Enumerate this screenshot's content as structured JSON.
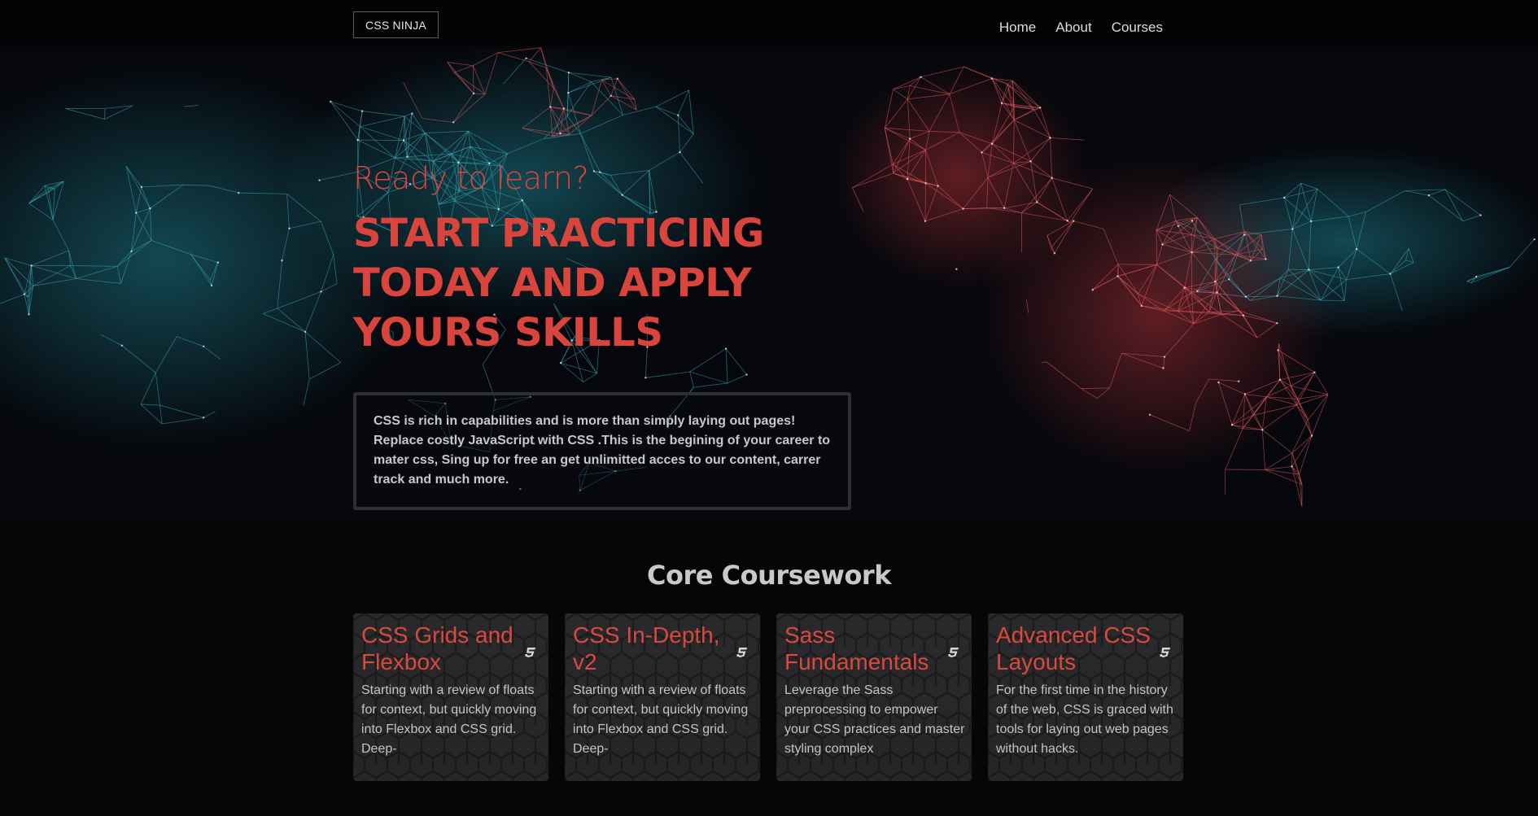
{
  "header": {
    "logo": "CSS NINJA",
    "nav": [
      {
        "label": "Home"
      },
      {
        "label": "About"
      },
      {
        "label": "Courses"
      }
    ]
  },
  "hero": {
    "eyebrow": "Ready to learn?",
    "headline": "Start practicing today and apply yours skills",
    "intro": "CSS is rich in capabilities and is more than simply laying out pages! Replace costly JavaScript with CSS .This is the begining of your career to mater css, Sing up for free an get unlimitted acces to our content, carrer track and much more."
  },
  "coursework": {
    "title": "Core Coursework",
    "cards": [
      {
        "title": "CSS Grids and Flexbox",
        "description": "Starting with a review of floats for context, but quickly moving into Flexbox and CSS grid. Deep-",
        "icon": "css3-icon"
      },
      {
        "title": "CSS In-Depth, v2",
        "description": "Starting with a review of floats for context, but quickly moving into Flexbox and CSS grid. Deep-",
        "icon": "css3-icon"
      },
      {
        "title": "Sass Fundamentals",
        "description": "Leverage the Sass preprocessing to empower your CSS practices and master styling complex",
        "icon": "css3-icon"
      },
      {
        "title": "Advanced CSS Layouts",
        "description": "For the first time in the history of the web, CSS is graced with tools for laying out web pages without hacks.",
        "icon": "css3-icon"
      }
    ]
  },
  "colors": {
    "accent": "#d9453d",
    "background": "#050606",
    "card": "#2a2a2c"
  }
}
